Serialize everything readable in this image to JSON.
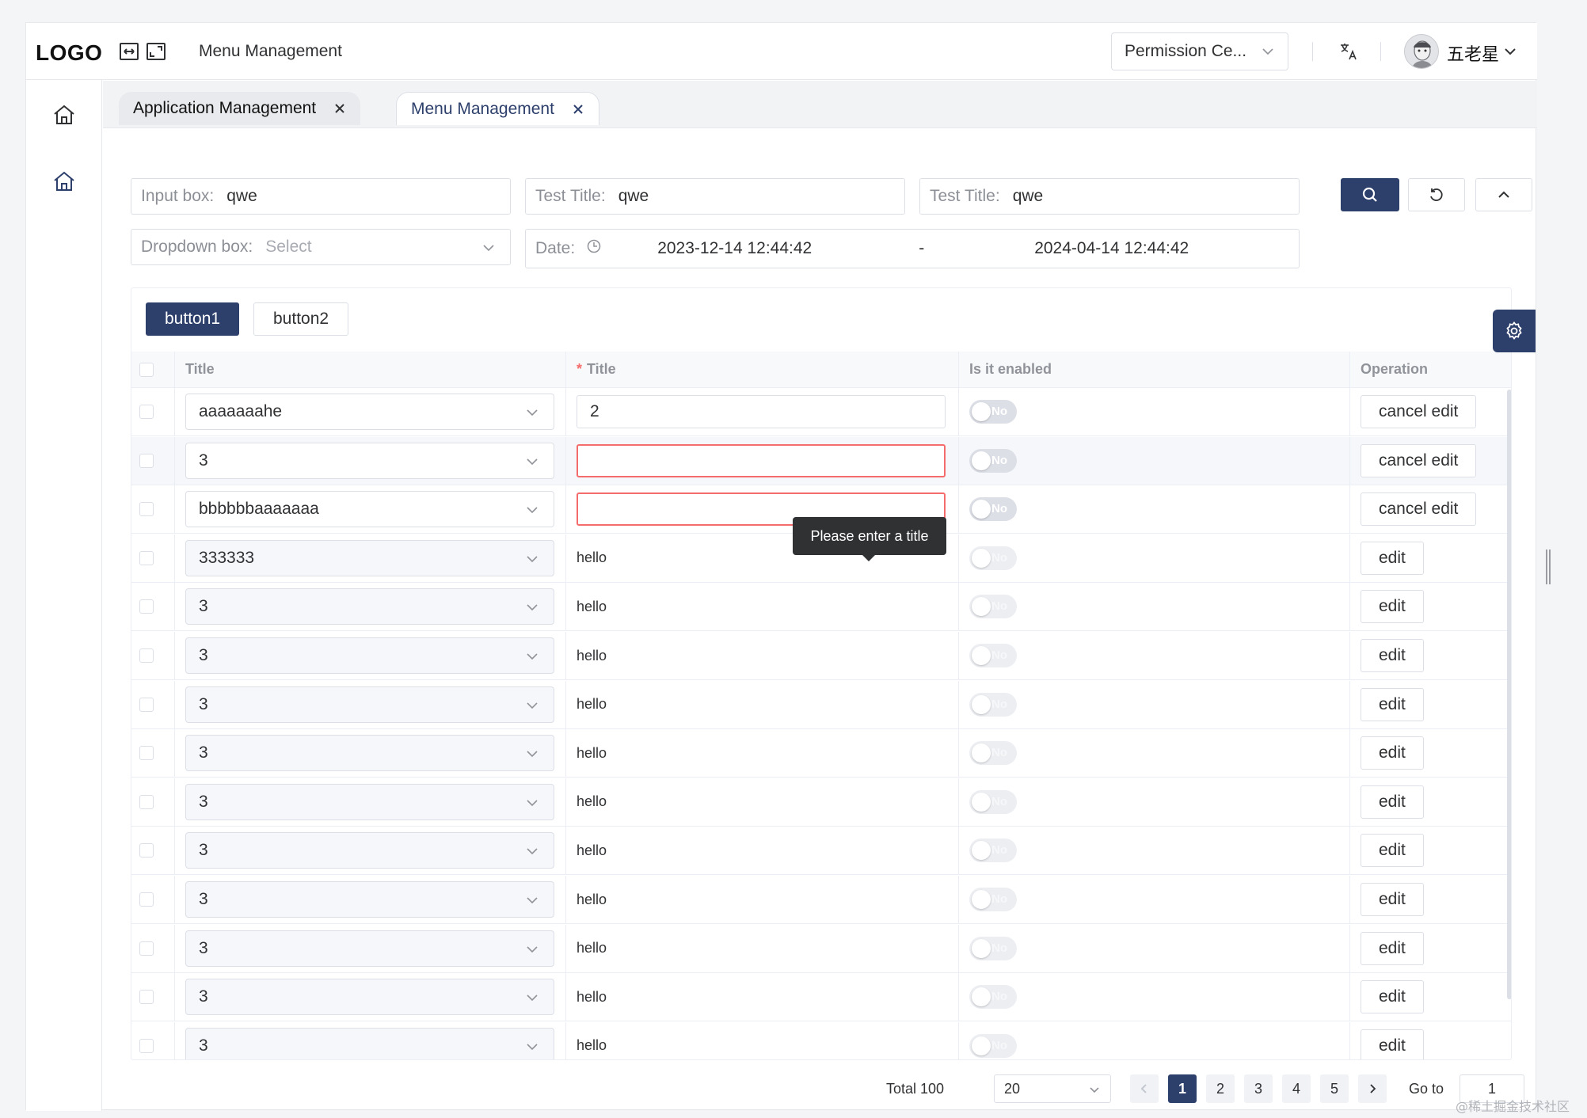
{
  "header": {
    "logo": "LOGO",
    "title": "Menu Management",
    "permission_select": "Permission Ce...",
    "username": "五老星"
  },
  "tabs": [
    {
      "label": "Application Management",
      "active": false
    },
    {
      "label": "Menu Management",
      "active": true
    }
  ],
  "filters": {
    "input_box": {
      "label": "Input box:",
      "value": "qwe"
    },
    "test_title_1": {
      "label": "Test Title:",
      "value": "qwe"
    },
    "test_title_2": {
      "label": "Test Title:",
      "value": "qwe"
    },
    "dropdown": {
      "label": "Dropdown box:",
      "placeholder": "Select"
    },
    "date": {
      "label": "Date:",
      "start": "2023-12-14 12:44:42",
      "separator": "-",
      "end": "2024-04-14 12:44:42"
    }
  },
  "toolbar": {
    "button1": "button1",
    "button2": "button2"
  },
  "table": {
    "headers": {
      "title": "Title",
      "required_mark": "*",
      "title2": "Title",
      "enabled": "Is it enabled",
      "operation": "Operation"
    },
    "rows": [
      {
        "select": "aaaaaaahe",
        "title": "2",
        "edit_mode": true,
        "error": false,
        "enabled": "No",
        "op": "cancel edit"
      },
      {
        "select": "3",
        "title": "",
        "edit_mode": true,
        "error": true,
        "enabled": "No",
        "op": "cancel edit"
      },
      {
        "select": "bbbbbbaaaaaaa",
        "title": "",
        "edit_mode": true,
        "error": true,
        "enabled": "No",
        "op": "cancel edit"
      },
      {
        "select": "333333",
        "title": "hello",
        "edit_mode": false,
        "enabled": "No",
        "op": "edit"
      },
      {
        "select": "3",
        "title": "hello",
        "edit_mode": false,
        "enabled": "No",
        "op": "edit"
      },
      {
        "select": "3",
        "title": "hello",
        "edit_mode": false,
        "enabled": "No",
        "op": "edit"
      },
      {
        "select": "3",
        "title": "hello",
        "edit_mode": false,
        "enabled": "No",
        "op": "edit"
      },
      {
        "select": "3",
        "title": "hello",
        "edit_mode": false,
        "enabled": "No",
        "op": "edit"
      },
      {
        "select": "3",
        "title": "hello",
        "edit_mode": false,
        "enabled": "No",
        "op": "edit"
      },
      {
        "select": "3",
        "title": "hello",
        "edit_mode": false,
        "enabled": "No",
        "op": "edit"
      },
      {
        "select": "3",
        "title": "hello",
        "edit_mode": false,
        "enabled": "No",
        "op": "edit"
      },
      {
        "select": "3",
        "title": "hello",
        "edit_mode": false,
        "enabled": "No",
        "op": "edit"
      },
      {
        "select": "3",
        "title": "hello",
        "edit_mode": false,
        "enabled": "No",
        "op": "edit"
      },
      {
        "select": "3",
        "title": "hello",
        "edit_mode": false,
        "enabled": "No",
        "op": "edit"
      }
    ],
    "tooltip": "Please enter a title"
  },
  "pagination": {
    "total": "Total 100",
    "page_size": "20",
    "pages": [
      "1",
      "2",
      "3",
      "4",
      "5"
    ],
    "current": "1",
    "goto_label": "Go to",
    "goto_value": "1"
  },
  "watermark": "@稀土掘金技术社区",
  "colors": {
    "primary": "#2d3f6b",
    "error": "#f56c6c",
    "border": "#dcdfe6"
  }
}
